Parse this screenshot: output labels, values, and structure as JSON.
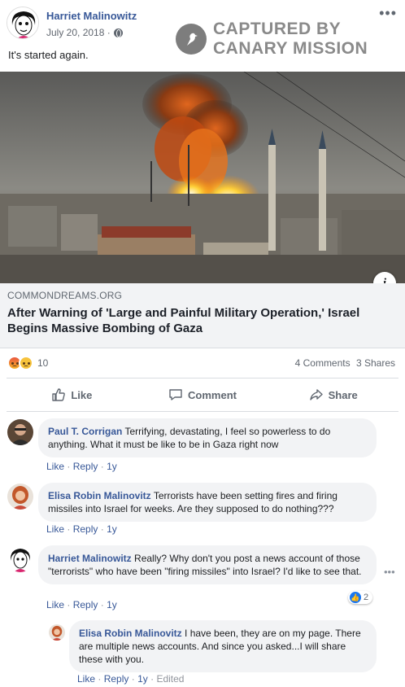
{
  "post": {
    "author": "Harriet Malinowitz",
    "date": "July 20, 2018 ·",
    "privacy_icon": "globe-icon",
    "text": "It's started again.",
    "more_icon": "more-options-icon"
  },
  "watermark": {
    "line1": "CAPTURED BY",
    "line2": "CANARY MISSION"
  },
  "link": {
    "domain": "COMMONDREAMS.ORG",
    "title": "After Warning of 'Large and Painful Military Operation,' Israel Begins Massive Bombing of Gaza",
    "info_label": "i"
  },
  "stats": {
    "reaction_count": "10",
    "comments": "4 Comments",
    "shares": "3 Shares"
  },
  "actions": {
    "like": "Like",
    "comment": "Comment",
    "share": "Share"
  },
  "comments": [
    {
      "name": "Paul T. Corrigan",
      "text": "Terrifying, devastating, I feel so powerless to do anything. What it must be like to be in Gaza right now",
      "like": "Like",
      "reply": "Reply",
      "time": "1y"
    },
    {
      "name": "Elisa Robin Malinovitz",
      "text": "Terrorists have been setting fires and firing missiles into Israel for weeks. Are they supposed to do nothing???",
      "like": "Like",
      "reply": "Reply",
      "time": "1y"
    },
    {
      "name": "Harriet Malinowitz",
      "text": "Really? Why don't you post a news account of those \"terrorists\" who have been \"firing missiles\" into Israel? I'd like to see that.",
      "like": "Like",
      "reply": "Reply",
      "time": "1y",
      "likes": "2"
    },
    {
      "name": "Elisa Robin Malinovitz",
      "text": "I have been, they are on my page. There are multiple news accounts. And since you asked...I will share these with you.",
      "like": "Like",
      "reply": "Reply",
      "time": "1y",
      "edited": "Edited"
    }
  ],
  "colors": {
    "link_blue": "#385898",
    "bubble": "#f2f3f5",
    "muted": "#606770"
  }
}
